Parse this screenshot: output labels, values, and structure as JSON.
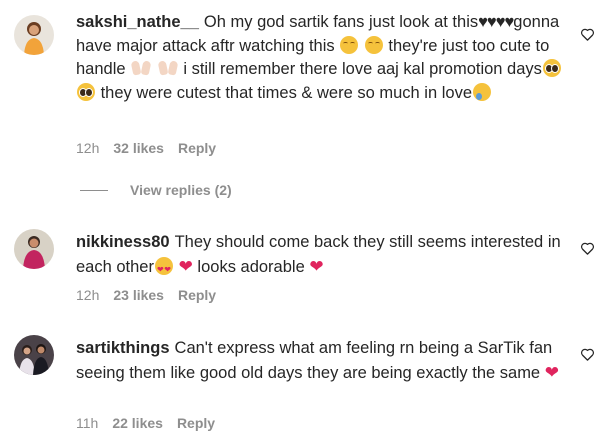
{
  "comments": [
    {
      "username": "sakshi_nathe__",
      "segments": {
        "t1": "Oh my god sartik fans just look at this",
        "hearts": "♥♥♥♥",
        "t2": "gonna have major attack aftr watching this",
        "t3": "they're just too cute to handle",
        "t4": "i still remember there love aaj kal promotion days",
        "t5": "they were cutest that times & were so much in love"
      },
      "time": "12h",
      "likes": "32 likes",
      "reply": "Reply",
      "view_replies": "View replies (2)"
    },
    {
      "username": "nikkiness80",
      "segments": {
        "t1": "They should come back they still seems interested in each other",
        "t2": "looks adorable"
      },
      "time": "12h",
      "likes": "23 likes",
      "reply": "Reply"
    },
    {
      "username": "sartikthings",
      "segments": {
        "t1": "Can't express what am feeling rn being a SarTik fan seeing them like good old days they are being exactly the same"
      },
      "time": "11h",
      "likes": "22 likes",
      "reply": "Reply"
    }
  ],
  "colors": {
    "text": "#262626",
    "muted": "#8e8e8e",
    "red_heart": "#e0245e"
  },
  "icons": [
    "heart-outline-icon",
    "relieved-face-emoji",
    "raising-hands-emoji",
    "pleading-face-emoji",
    "crying-face-emoji",
    "heart-eyes-emoji",
    "red-heart-emoji"
  ]
}
